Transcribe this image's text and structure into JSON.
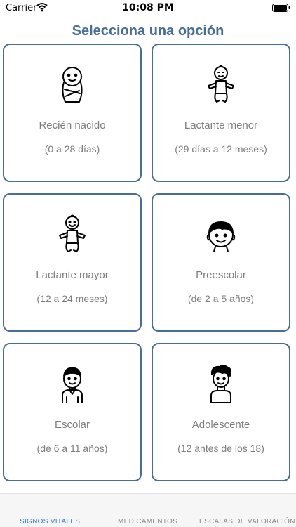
{
  "status_bar": {
    "carrier": "Carrier",
    "time": "10:08 PM",
    "icons": [
      "wifi-icon",
      "battery-icon"
    ]
  },
  "header": {
    "title": "Selecciona una opción",
    "title_color": "#476E9B"
  },
  "options": [
    {
      "label": "Recién nacido",
      "range": "(0 a 28 días)",
      "icon": "swaddled-baby-icon"
    },
    {
      "label": "Lactante menor",
      "range": "(29 días a 12 meses)",
      "icon": "infant-icon"
    },
    {
      "label": "Lactante mayor",
      "range": "(12 a 24 meses)",
      "icon": "older-infant-icon"
    },
    {
      "label": "Preescolar",
      "range": "(de 2 a 5 años)",
      "icon": "preschooler-icon"
    },
    {
      "label": "Escolar",
      "range": "(de 6 a 11 años)",
      "icon": "schoolchild-icon"
    },
    {
      "label": "Adolescente",
      "range": "(12 antes de los 18)",
      "icon": "adolescent-icon"
    }
  ],
  "tabs": [
    {
      "label": "SIGNOS VITALES",
      "active": true
    },
    {
      "label": "MEDICAMENTOS",
      "active": false
    },
    {
      "label": "ESCALAS DE VALORACIÓN",
      "active": false
    }
  ],
  "colors": {
    "accent": "#476E9B",
    "active_tab": "#2f78d6",
    "inactive_tab": "#888888",
    "muted_text": "#7d7d7d"
  }
}
